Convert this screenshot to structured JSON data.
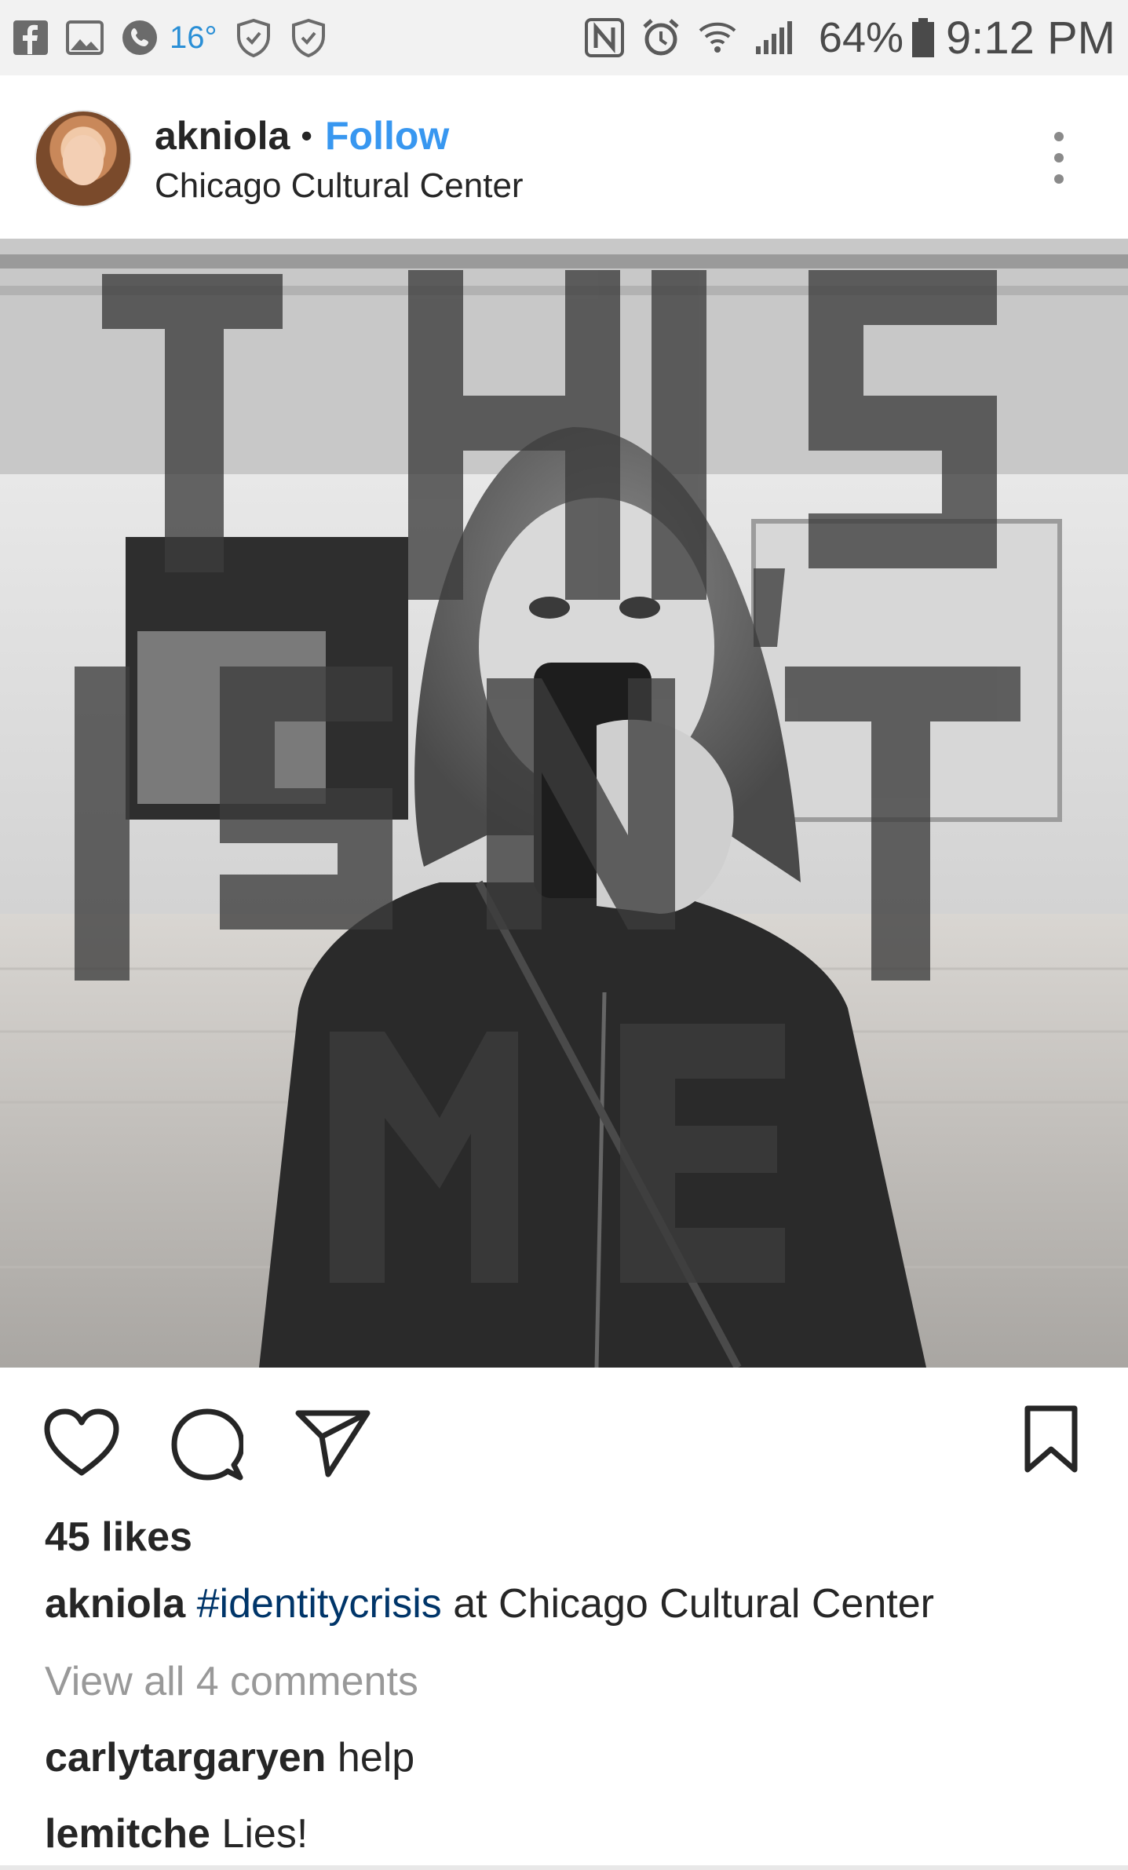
{
  "status_bar": {
    "temperature": "16°",
    "battery_percent": "64%",
    "time": "9:12 PM",
    "left_icons": [
      "facebook-icon",
      "gallery-icon",
      "phone-icon",
      "shield-icon",
      "shield-icon"
    ],
    "right_icons": [
      "nfc-icon",
      "alarm-icon",
      "wifi-icon",
      "signal-icon",
      "battery-icon"
    ]
  },
  "post": {
    "username": "akniola",
    "separator": "•",
    "follow_label": "Follow",
    "location": "Chicago Cultural Center",
    "photo_alt": "Black and white mirror selfie behind painted text THIS ISN'T ME",
    "photo_text": {
      "line1": "THIS",
      "line2": "ISN'T",
      "line3": "ME"
    }
  },
  "actions": {
    "icons": [
      "heart-icon",
      "comment-icon",
      "share-icon",
      "bookmark-icon"
    ]
  },
  "engagement": {
    "likes": "45 likes",
    "caption_user": "akniola",
    "caption_hashtag": "#identitycrisis",
    "caption_rest": " at Chicago Cultural Center",
    "view_all": "View all 4 comments"
  },
  "comments": [
    {
      "user": "carlytargaryen",
      "text": " help"
    },
    {
      "user": "lemitche",
      "text": " Lies!"
    }
  ],
  "colors": {
    "follow_blue": "#3897f0",
    "hashtag_navy": "#003569",
    "muted_gray": "#999999",
    "temperature_blue": "#2a8fd6"
  }
}
